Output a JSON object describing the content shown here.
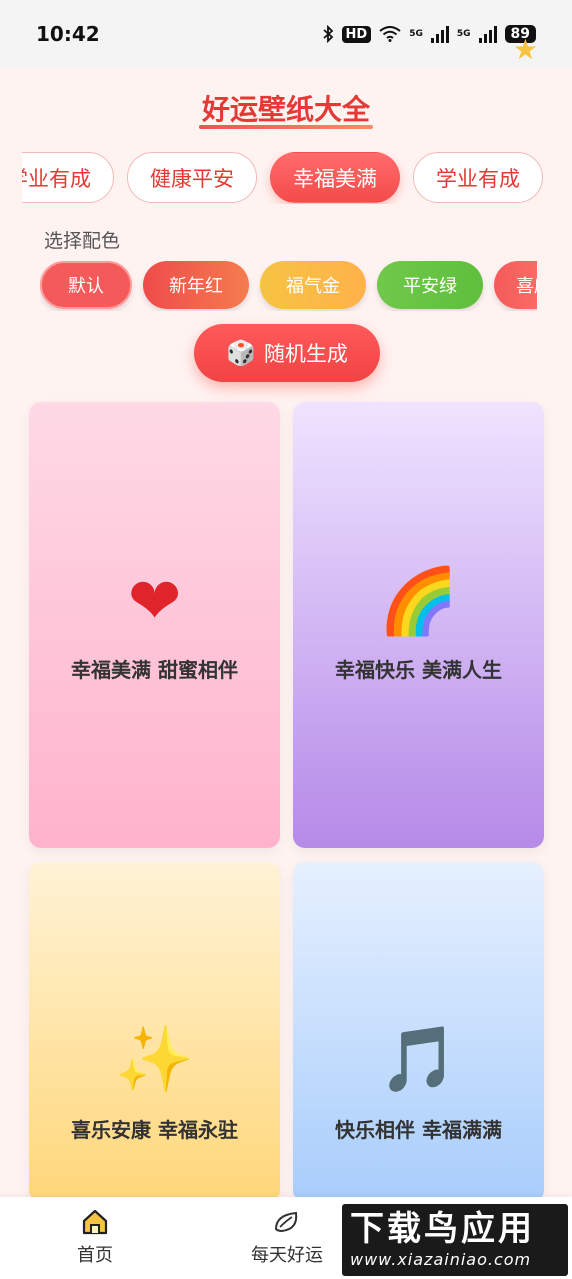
{
  "status_bar": {
    "time": "10:42",
    "hd": "HD",
    "net1": "5G",
    "net2": "5G",
    "battery": "89"
  },
  "header": {
    "title": "好运壁纸大全"
  },
  "categories": [
    {
      "label": "学业有成"
    },
    {
      "label": "健康平安"
    },
    {
      "label": "幸福美满",
      "active": true
    },
    {
      "label": "学业有成"
    }
  ],
  "color_section": {
    "label": "选择配色",
    "options": [
      {
        "label": "默认"
      },
      {
        "label": "新年红"
      },
      {
        "label": "福气金"
      },
      {
        "label": "平安绿"
      },
      {
        "label": "喜庆"
      }
    ]
  },
  "random_button": {
    "icon": "dice-icon",
    "label": "随机生成"
  },
  "cards": [
    {
      "icon": "heart-icon",
      "glyph": "❤",
      "caption": "幸福美满 甜蜜相伴"
    },
    {
      "icon": "rainbow-icon",
      "glyph": "🌈",
      "caption": "幸福快乐 美满人生"
    },
    {
      "icon": "sparkles-icon",
      "glyph": "✨",
      "caption": "喜乐安康 幸福永驻"
    },
    {
      "icon": "music-note-icon",
      "glyph": "🎵",
      "caption": "快乐相伴 幸福满满"
    }
  ],
  "bottom_nav": {
    "items": [
      {
        "label": "首页",
        "icon": "home-icon"
      },
      {
        "label": "每天好运",
        "icon": "leaf-icon"
      }
    ]
  },
  "watermark": {
    "main": "下载鸟应用",
    "sub": "www.xiazainiao.com"
  },
  "colors": {
    "accent": "#f44b4b",
    "background": "#fff3f2"
  }
}
